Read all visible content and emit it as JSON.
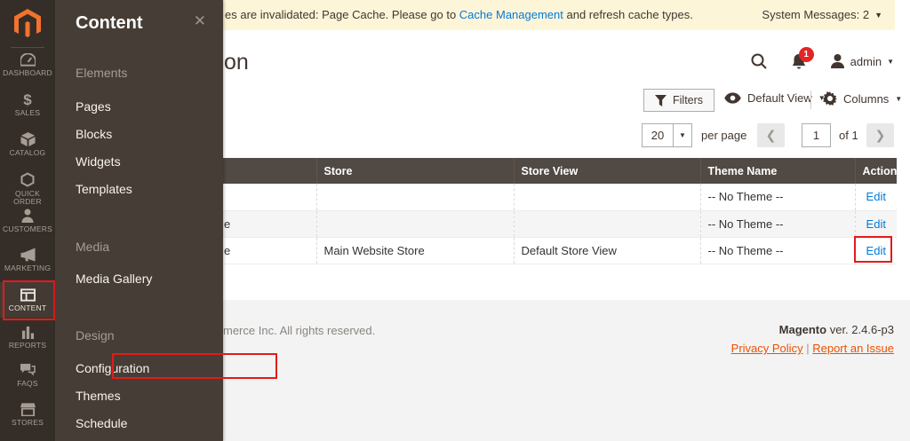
{
  "colors": {
    "accent_orange": "#eb5202",
    "link_blue": "#007bdb",
    "annotation_red": "#e21b1b",
    "notice_bg": "#fdf5d8",
    "grid_header_bg": "#514943",
    "sidebar_bg": "#352e28",
    "flyout_bg": "#463d36",
    "badge_red": "#e22626"
  },
  "notice": {
    "message_visible_start": "es are invalidated: Page Cache. Please go to ",
    "link_label": "Cache Management",
    "message_visible_end": " and refresh cache types.",
    "system_messages_label": "System Messages: 2"
  },
  "header": {
    "page_title_visible_fragment": "on",
    "notification_count": "1",
    "user_name": "admin",
    "icons": [
      "search-icon",
      "bell-icon",
      "user-icon"
    ]
  },
  "toolbar": {
    "filters_label": "Filters",
    "view_label": "Default View",
    "columns_label": "Columns"
  },
  "pagination": {
    "page_size": "20",
    "per_page_label": "per page",
    "current_page": "1",
    "of_label": "of 1"
  },
  "grid": {
    "columns": [
      "",
      "Store",
      "Store View",
      "Theme Name",
      "Action"
    ],
    "rows": [
      {
        "website_fragment": "",
        "store": "",
        "store_view": "",
        "theme": "-- No Theme --",
        "action": "Edit"
      },
      {
        "website_fragment": "e",
        "store": "",
        "store_view": "",
        "theme": "-- No Theme --",
        "action": "Edit"
      },
      {
        "website_fragment": "e",
        "store": "Main Website Store",
        "store_view": "Default Store View",
        "theme": "-- No Theme --",
        "action": "Edit"
      }
    ]
  },
  "footer": {
    "copyright_visible_fragment": "merce Inc. All rights reserved.",
    "brand": "Magento",
    "version": "ver. 2.4.6-p3",
    "privacy_label": "Privacy Policy",
    "separator": "|",
    "report_label": "Report an Issue"
  },
  "sidebar": {
    "items": [
      {
        "label": "DASHBOARD",
        "icon": "gauge-icon"
      },
      {
        "label": "SALES",
        "icon": "dollar-icon"
      },
      {
        "label": "CATALOG",
        "icon": "box-icon"
      },
      {
        "label": "QUICK ORDER",
        "icon": "hexagon-icon"
      },
      {
        "label": "CUSTOMERS",
        "icon": "person-icon"
      },
      {
        "label": "MARKETING",
        "icon": "megaphone-icon"
      },
      {
        "label": "CONTENT",
        "icon": "layout-icon"
      },
      {
        "label": "REPORTS",
        "icon": "bar-chart-icon"
      },
      {
        "label": "FAQS",
        "icon": "faq-bubble-icon"
      },
      {
        "label": "STORES",
        "icon": "storefront-icon"
      }
    ]
  },
  "flyout": {
    "title": "Content",
    "sections": [
      {
        "heading": "Elements",
        "items": [
          "Pages",
          "Blocks",
          "Widgets",
          "Templates"
        ]
      },
      {
        "heading": "Media",
        "items": [
          "Media Gallery"
        ]
      },
      {
        "heading": "Design",
        "items": [
          "Configuration",
          "Themes",
          "Schedule"
        ]
      }
    ]
  }
}
